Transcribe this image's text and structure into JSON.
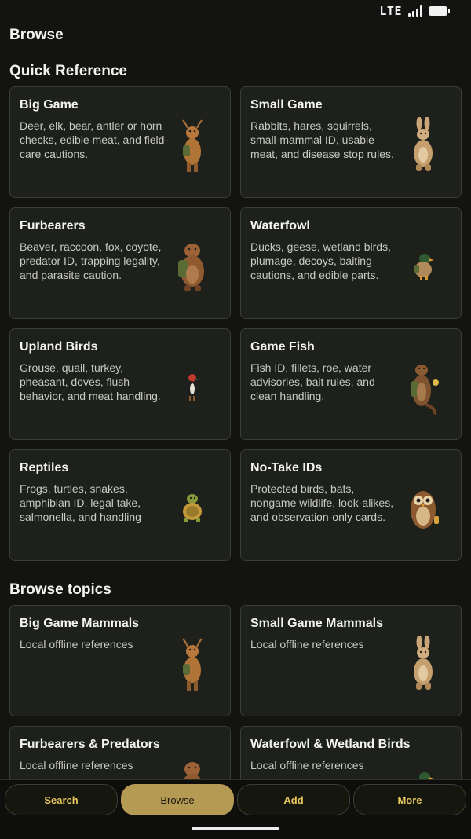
{
  "status_bar": {
    "network": "LTE"
  },
  "page_title": "Browse",
  "quick_reference": {
    "heading": "Quick Reference",
    "cards": [
      {
        "title": "Big Game",
        "description": "Deer, elk, bear, antler or horn checks, edible meat, and field-care cautions.",
        "icon": "deer-icon"
      },
      {
        "title": "Small Game",
        "description": "Rabbits, hares, squirrels, small-mammal ID, usable meat, and disease stop rules.",
        "icon": "rabbit-icon"
      },
      {
        "title": "Furbearers",
        "description": "Beaver, raccoon, fox, coyote, predator ID, trapping legality, and parasite caution.",
        "icon": "beaver-icon"
      },
      {
        "title": "Waterfowl",
        "description": "Ducks, geese, wetland birds, plumage, decoys, baiting cautions, and edible parts.",
        "icon": "duck-icon"
      },
      {
        "title": "Upland Birds",
        "description": "Grouse, quail, turkey, pheasant, doves, flush behavior, and meat handling.",
        "icon": "woodpecker-icon"
      },
      {
        "title": "Game Fish",
        "description": "Fish ID, fillets, roe, water advisories, bait rules, and clean handling.",
        "icon": "otter-icon"
      },
      {
        "title": "Reptiles",
        "description": "Frogs, turtles, snakes, amphibian ID, legal take, salmonella, and handling",
        "icon": "turtle-icon"
      },
      {
        "title": "No-Take IDs",
        "description": "Protected birds, bats, nongame wildlife, look-alikes, and observation-only cards.",
        "icon": "owl-icon"
      }
    ]
  },
  "browse_topics": {
    "heading": "Browse topics",
    "cards": [
      {
        "title": "Big Game Mammals",
        "description": "Local offline references",
        "icon": "deer-icon"
      },
      {
        "title": "Small Game Mammals",
        "description": "Local offline references",
        "icon": "rabbit-icon"
      },
      {
        "title": "Furbearers & Predators",
        "description": "Local offline references",
        "icon": "beaver-icon"
      },
      {
        "title": "Waterfowl & Wetland Birds",
        "description": "Local offline references",
        "icon": "duck-icon"
      }
    ]
  },
  "bottom_nav": {
    "items": [
      "Search",
      "Browse",
      "Add",
      "More"
    ],
    "active": "Browse"
  },
  "colors": {
    "accent": "#b49a52",
    "nav_text": "#e7c65f",
    "card_bg": "#1d201b",
    "page_bg": "#131411"
  }
}
